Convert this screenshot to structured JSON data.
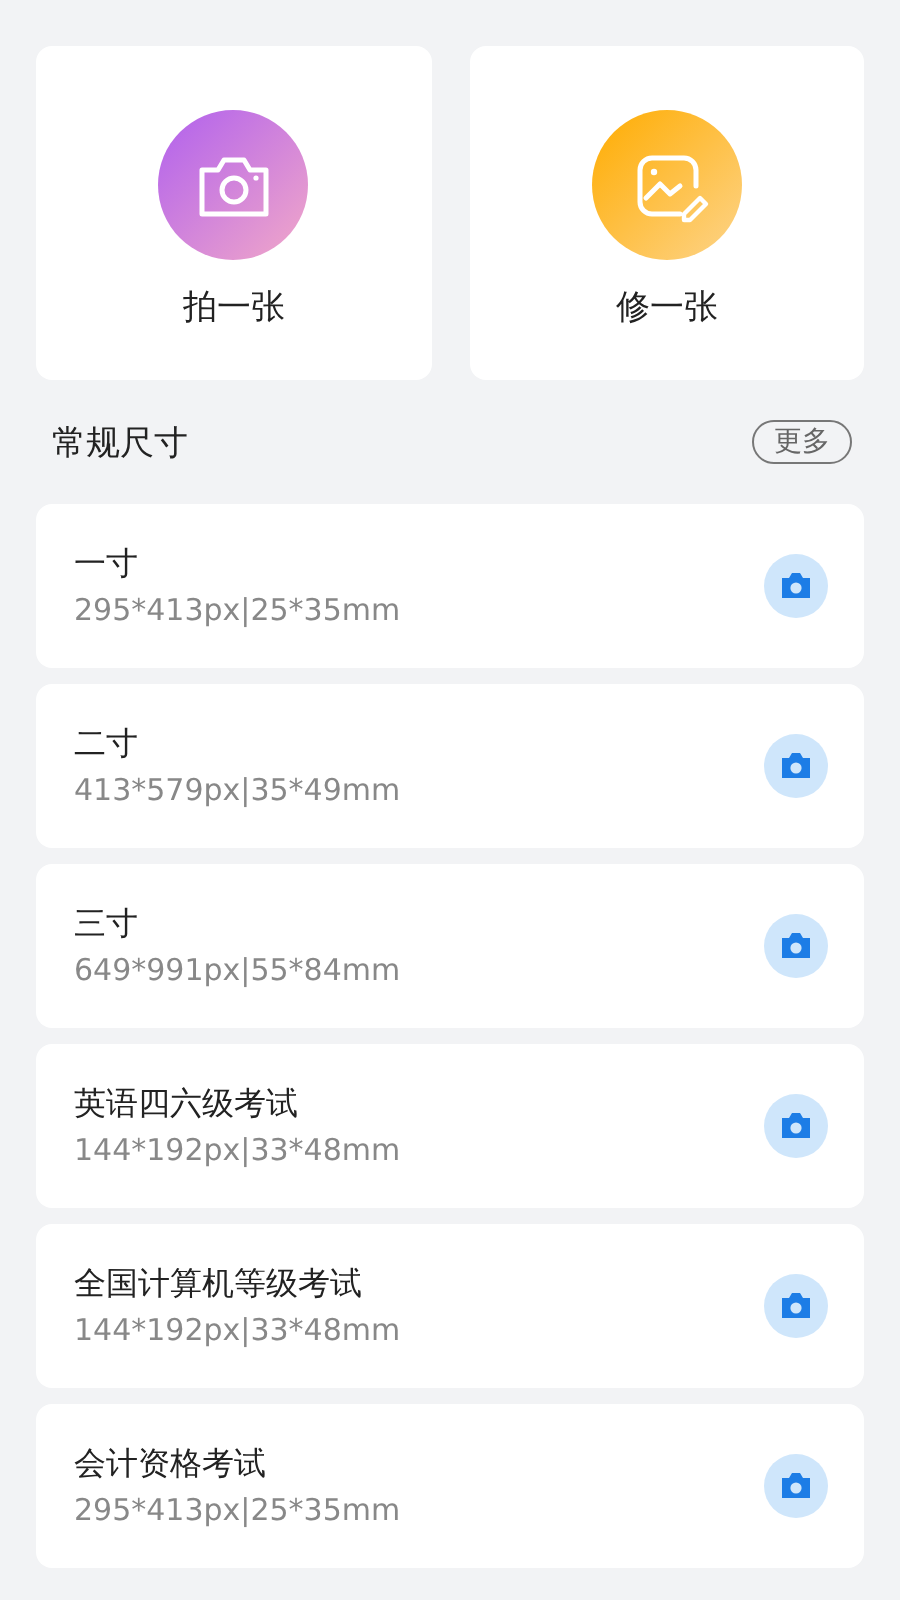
{
  "actions": [
    {
      "kind": "camera",
      "label": "拍一张"
    },
    {
      "kind": "edit",
      "label": "修一张"
    }
  ],
  "section": {
    "title": "常规尺寸",
    "more": "更多"
  },
  "sizes": [
    {
      "name": "一寸",
      "spec": "295*413px|25*35mm"
    },
    {
      "name": "二寸",
      "spec": "413*579px|35*49mm"
    },
    {
      "name": "三寸",
      "spec": "649*991px|55*84mm"
    },
    {
      "name": "英语四六级考试",
      "spec": "144*192px|33*48mm"
    },
    {
      "name": "全国计算机等级考试",
      "spec": "144*192px|33*48mm"
    },
    {
      "name": "会计资格考试",
      "spec": "295*413px|25*35mm"
    }
  ]
}
